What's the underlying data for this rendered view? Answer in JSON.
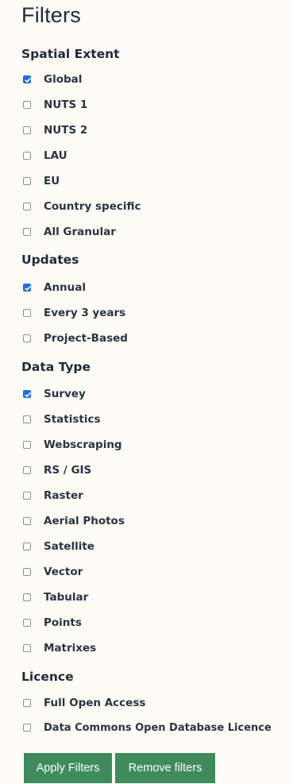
{
  "title": "Filters",
  "groups": [
    {
      "heading": "Spatial Extent",
      "options": [
        {
          "label": "Global",
          "checked": true
        },
        {
          "label": "NUTS 1",
          "checked": false
        },
        {
          "label": "NUTS 2",
          "checked": false
        },
        {
          "label": "LAU",
          "checked": false
        },
        {
          "label": "EU",
          "checked": false
        },
        {
          "label": "Country specific",
          "checked": false
        },
        {
          "label": "All Granular",
          "checked": false
        }
      ]
    },
    {
      "heading": "Updates",
      "options": [
        {
          "label": "Annual",
          "checked": true
        },
        {
          "label": "Every 3 years",
          "checked": false
        },
        {
          "label": "Project-Based",
          "checked": false
        }
      ]
    },
    {
      "heading": "Data Type",
      "options": [
        {
          "label": "Survey",
          "checked": true
        },
        {
          "label": "Statistics",
          "checked": false
        },
        {
          "label": "Webscraping",
          "checked": false
        },
        {
          "label": "RS / GIS",
          "checked": false
        },
        {
          "label": "Raster",
          "checked": false
        },
        {
          "label": "Aerial Photos",
          "checked": false
        },
        {
          "label": "Satellite",
          "checked": false
        },
        {
          "label": "Vector",
          "checked": false
        },
        {
          "label": "Tabular",
          "checked": false
        },
        {
          "label": "Points",
          "checked": false
        },
        {
          "label": "Matrixes",
          "checked": false
        }
      ]
    },
    {
      "heading": "Licence",
      "options": [
        {
          "label": "Full Open Access",
          "checked": false
        },
        {
          "label": "Data Commons Open Database Licence",
          "checked": false
        }
      ]
    }
  ],
  "buttons": {
    "apply": "Apply Filters",
    "remove": "Remove filters"
  },
  "colors": {
    "background": "#fdfcf5",
    "checkbox_checked": "#1f6fd6",
    "button": "#3f8b5c",
    "text": "#1e2a3a"
  }
}
